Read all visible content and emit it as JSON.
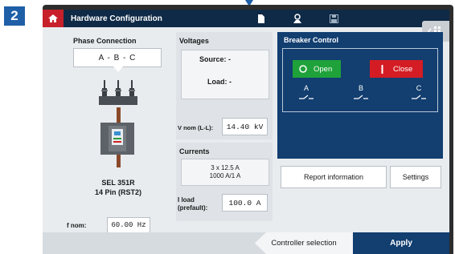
{
  "step": {
    "number": "2"
  },
  "titlebar": {
    "title": "Hardware Configuration"
  },
  "phase": {
    "heading": "Phase Connection",
    "selection": "A - B - C",
    "relay_name": "SEL 351R",
    "relay_pins": "14 Pin (RST2)",
    "fnom_label": "f nom:",
    "fnom_value": "60.00 Hz"
  },
  "voltages": {
    "heading": "Voltages",
    "source": "Source: -",
    "load": "Load: -",
    "vnom_label": "V nom (L-L):",
    "vnom_value": "14.40 kV"
  },
  "currents": {
    "heading": "Currents",
    "ratio_line1": "3 x 12.5 A",
    "ratio_line2": "1000 A/1 A",
    "iload_label_1": "I load",
    "iload_label_2": "(prefault):",
    "iload_value": "100.0 A"
  },
  "breaker": {
    "heading": "Breaker Control",
    "open_label": "Open",
    "close_label": "Close",
    "phases": [
      "A",
      "B",
      "C"
    ]
  },
  "actions": {
    "report": "Report information",
    "settings": "Settings"
  },
  "bottom": {
    "controller_selection": "Controller selection",
    "apply": "Apply"
  },
  "colors": {
    "navy": "#123e70",
    "open_green": "#1fa23a",
    "close_red": "#d41c24",
    "home_red": "#c8202a",
    "badge_blue": "#1f5fa8"
  }
}
